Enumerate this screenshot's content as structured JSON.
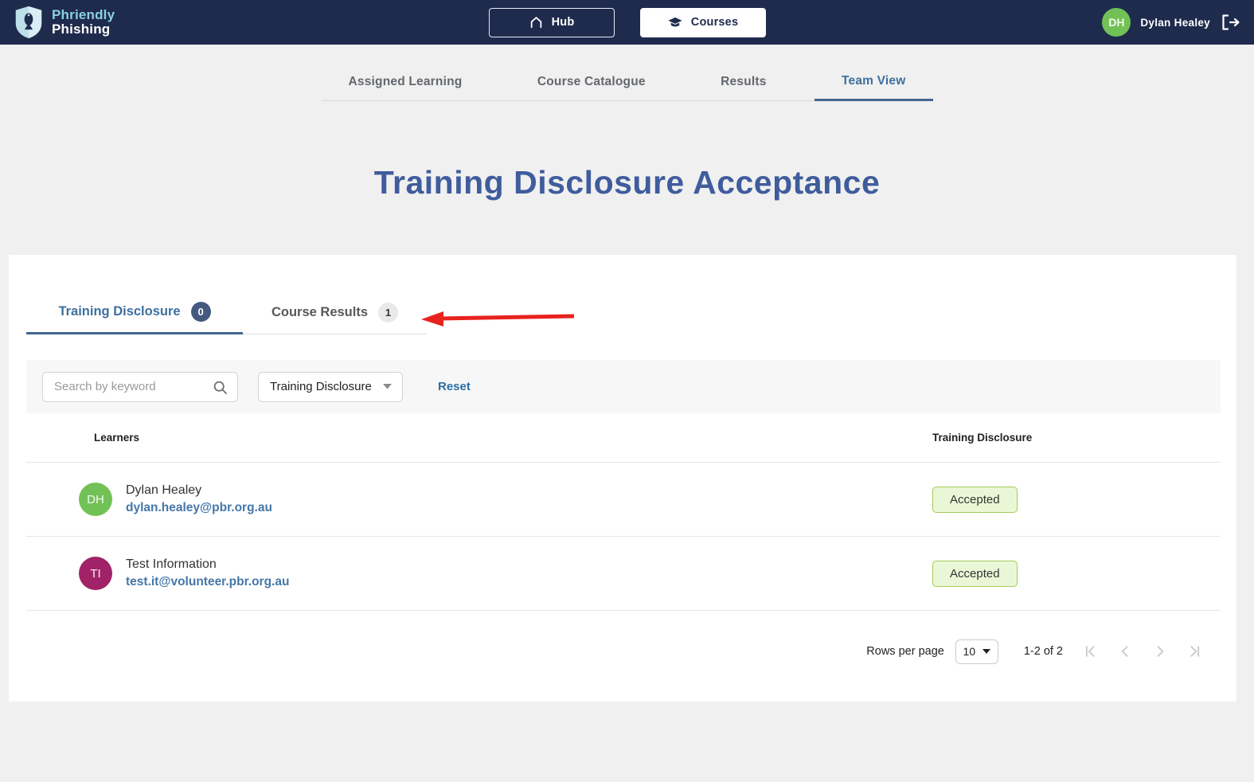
{
  "colors": {
    "navy": "#1f2b4d",
    "title-blue": "#3f5c9d",
    "tab-blue": "#3d6f9e",
    "link-blue": "#4577a8",
    "reset-blue": "#2e6da4",
    "badge-navy": "#44597e",
    "avatar-green": "#72c156",
    "avatar-magenta": "#a02368",
    "accepted-bg": "#eaf7d7",
    "accepted-border": "#a6ca56",
    "arrow-red": "#e8231d"
  },
  "header": {
    "brand_line1": "Phriendly",
    "brand_line2": "Phishing",
    "hub_label": "Hub",
    "courses_label": "Courses",
    "user": {
      "initials": "DH",
      "name": "Dylan Healey"
    }
  },
  "nav": {
    "tabs": [
      {
        "label": "Assigned Learning"
      },
      {
        "label": "Course Catalogue"
      },
      {
        "label": "Results"
      },
      {
        "label": "Team View"
      }
    ]
  },
  "page": {
    "title": "Training Disclosure Acceptance"
  },
  "card": {
    "tabs": [
      {
        "label": "Training Disclosure",
        "count": "0"
      },
      {
        "label": "Course Results",
        "count": "1"
      }
    ],
    "filters": {
      "search_placeholder": "Search by keyword",
      "filter_value": "Training Disclosure",
      "reset_label": "Reset"
    },
    "table": {
      "columns": [
        "Learners",
        "Training Disclosure"
      ],
      "rows": [
        {
          "initials": "DH",
          "name": "Dylan Healey",
          "email": "dylan.healey@pbr.org.au",
          "status": "Accepted",
          "avatar_color": "#72c156"
        },
        {
          "initials": "TI",
          "name": "Test Information",
          "email": "test.it@volunteer.pbr.org.au",
          "status": "Accepted",
          "avatar_color": "#a02368"
        }
      ]
    },
    "pagination": {
      "rows_per_page_label": "Rows per page",
      "rows_per_page_value": "10",
      "range_label": "1-2 of 2"
    }
  }
}
